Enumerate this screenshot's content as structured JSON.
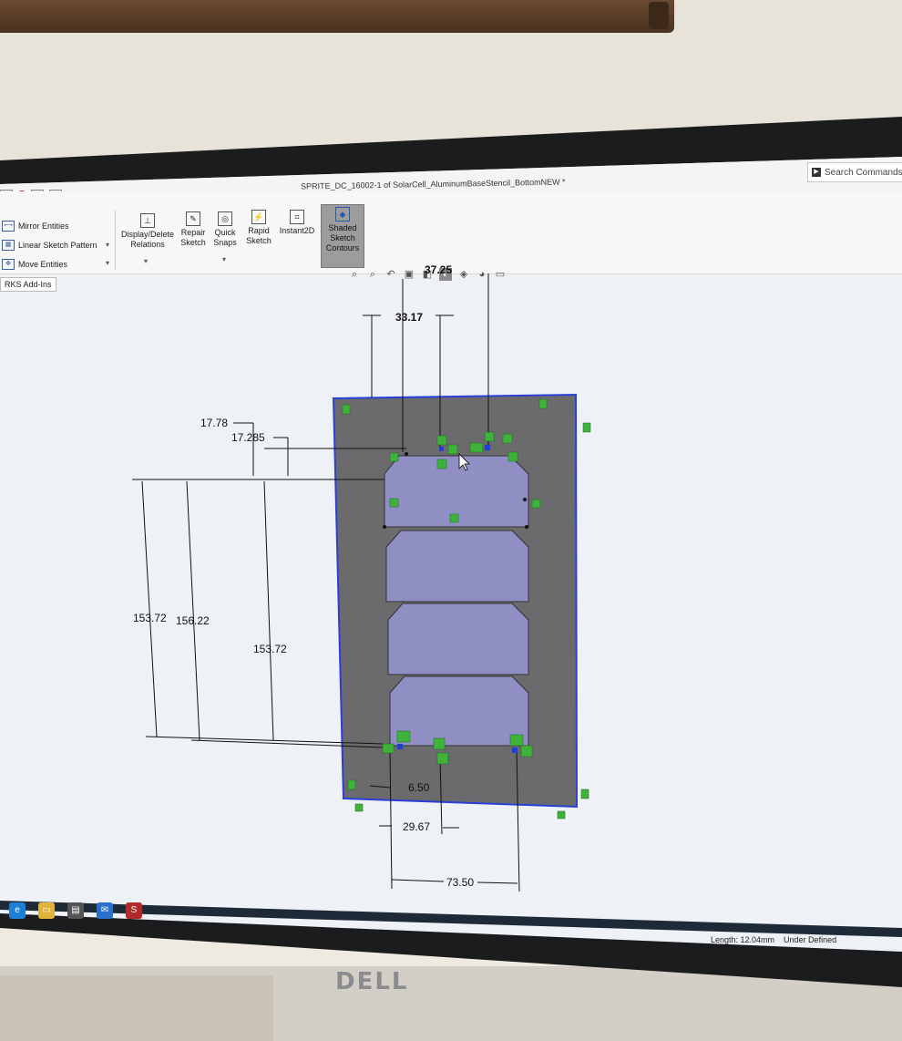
{
  "window": {
    "title": "SPRITE_DC_16002-1 of SolarCell_AluminumBaseStencil_BottomNEW *"
  },
  "search": {
    "placeholder": "Search Commands"
  },
  "ribbon": {
    "left_commands": [
      "Mirror Entities",
      "Linear Sketch Pattern",
      "Move Entities"
    ],
    "buttons": {
      "display_delete_relations": "Display/Delete Relations",
      "repair_sketch": "Repair Sketch",
      "quick_snaps": "Quick Snaps",
      "rapid_sketch": "Rapid Sketch",
      "instant2d": "Instant2D",
      "shaded_sketch_contours": "Shaded Sketch Contours"
    },
    "tab_addins": "RKS Add-Ins"
  },
  "dimensions": {
    "top_width": "33.17",
    "top_partial": "37.25",
    "left_small_1": "17.78",
    "left_small_2": "17.285",
    "height_1": "153.72",
    "height_2": "156.22",
    "height_3": "153.72",
    "bottom_small": "6.50",
    "bottom_mid": "29.67",
    "bottom_wide": "73.50"
  },
  "status": {
    "length": "Length: 12.04mm",
    "state": "Under Defined"
  },
  "monitor": {
    "brand": "DELL"
  },
  "colors": {
    "plate": "#6b6b6d",
    "cell": "#8f8fc4",
    "relation": "#3fb23c",
    "edge": "#2a3fd8"
  }
}
